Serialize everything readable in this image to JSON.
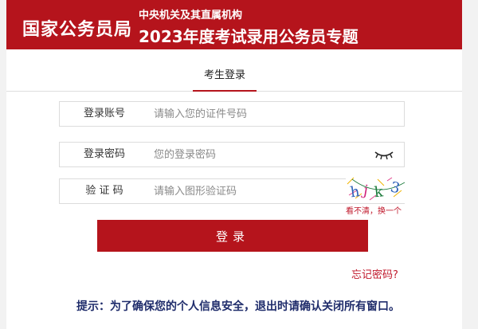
{
  "header": {
    "brand": "国家公务员局",
    "subtitle_line1": "中央机关及其直属机构",
    "subtitle_line2": "2023年度考试录用公务员专题"
  },
  "tabs": [
    {
      "label": "考生登录",
      "active": true
    }
  ],
  "form": {
    "account": {
      "label": "登录账号",
      "placeholder": "请输入您的证件号码"
    },
    "password": {
      "label": "登录密码",
      "placeholder": "您的登录密码",
      "icon": "eye-closed-icon"
    },
    "captcha": {
      "label": "验 证 码",
      "placeholder": "请输入图形验证码",
      "image_text": "hjk3",
      "refresh_label": "看不清，换一个"
    }
  },
  "submit_label": "登录",
  "forgot_label": "忘记密码?",
  "hint": "提示：为了确保您的个人信息安全，退出时请确认关闭所有窗口。",
  "colors": {
    "brand_red": "#b5141c",
    "link_red": "#c0182b",
    "hint_blue": "#1f2c6b"
  }
}
